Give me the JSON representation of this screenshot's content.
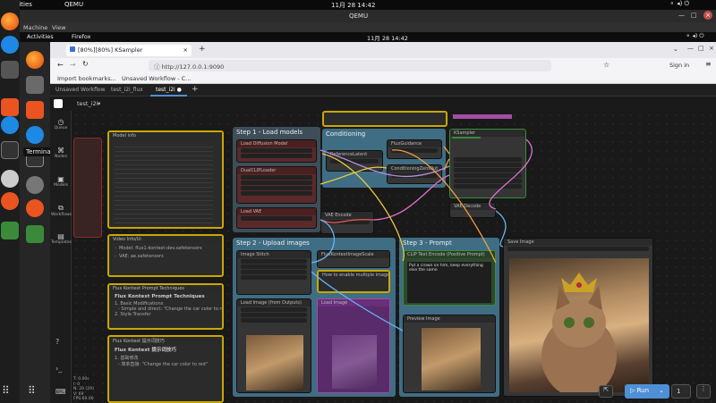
{
  "os": {
    "activities": "Activities",
    "app": "QEMU",
    "datetime": "11月 28  14:42"
  },
  "qemu": {
    "title": "QEMU",
    "menu": [
      "Machine",
      "View"
    ]
  },
  "guest": {
    "activities": "Activities",
    "app": "Firefox",
    "datetime": "11月 28  14:42"
  },
  "dock": {
    "tooltip": "Terminal"
  },
  "browser": {
    "tab_title": "[80%][80%] KSampler",
    "url": "http://127.0.0.1:9090",
    "bookmarks": [
      "Import bookmarks...",
      "Unsaved Workflow - C..."
    ],
    "sign_in": "Sign in"
  },
  "workflow_tabs": [
    {
      "label": "Unsaved Workflow"
    },
    {
      "label": "test_i2i_flux"
    },
    {
      "label": "test_i2i",
      "active": true,
      "dot": "●"
    }
  ],
  "toolbar": {
    "add": "+",
    "workflow_name": "test_i2i",
    "caret": "▾"
  },
  "sidebar": {
    "items": [
      "Queue",
      "Nodes",
      "Models",
      "Workflows",
      "Templates"
    ],
    "stats": [
      "T: 0.00s",
      "I: 0",
      "N: 29 [29]",
      "V: 69",
      "FPS:60.00"
    ]
  },
  "groups": {
    "g1": "Step 1 - Load models",
    "g2": "Conditioning",
    "g3": "Step 2 - Upload images",
    "g4": "Step 3 - Prompt"
  },
  "nodes": {
    "a": "Model info",
    "b": "Video Info/Ui",
    "c": "Flux Kontext Prompt Techniques",
    "d": "Flux Kontext 提示词技巧",
    "load_diffusion": "Load Diffusion Model",
    "dualclip": "DualCLIPLoader",
    "loadvae": "Load VAE",
    "ref_latent": "ReferenceLatent",
    "flux_guidance": "FluxGuidance",
    "cond_zero": "ConditioningZeroOut",
    "ksampler": "KSampler",
    "vae_encode": "VAE Encode",
    "vae_decode": "VAE Decode",
    "image_stitch": "Image Stitch",
    "fluxkontext_scale": "FluxKontextImageScale",
    "load_image": "Load Image",
    "load_image2": "Load Image (from Outputs)",
    "note_multi": "How to enable multiple image input",
    "clip_text": "CLIP Text Encode (Positive Prompt)",
    "prompt": "Put a crown on him, keep everything else the same",
    "preview": "Preview Image",
    "save": "Save Image",
    "run": "Run",
    "run_count": "1"
  },
  "markdown": {
    "b_lines": [
      "-  Model: flux1-kontext-dev.safetensors",
      "-  VAE: ae.safetensors"
    ],
    "c_heading": "Flux Kontext Prompt Techniques",
    "c_items": [
      "1. Basic Modifications",
      "- Simple and direct: \"Change the car color to red\"",
      "2. Style Transfer"
    ],
    "d_heading": "Flux Kontext 提示词技巧",
    "d_items": [
      "1. 基础修改",
      "- 简单直接: \"Change the car color to red\""
    ]
  },
  "accent": {
    "load": "#a24ea1",
    "blue_group": "#3f6d84",
    "yellow_border": "#c8a800",
    "green": "#3a8a3a",
    "red_node": "#6b2d2d",
    "run": "#4f8fd6"
  }
}
